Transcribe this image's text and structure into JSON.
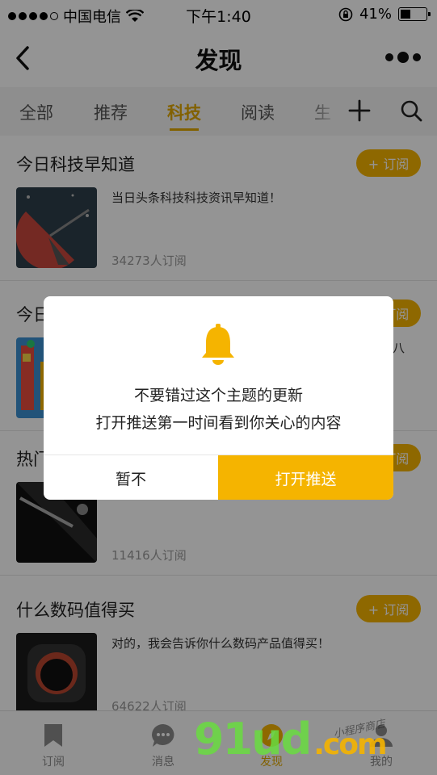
{
  "status_bar": {
    "carrier": "中国电信",
    "time": "下午1:40",
    "battery": "41%"
  },
  "nav": {
    "title": "发现"
  },
  "tabs": [
    {
      "label": "全部"
    },
    {
      "label": "推荐"
    },
    {
      "label": "科技"
    },
    {
      "label": "阅读"
    },
    {
      "label": "生"
    }
  ],
  "cards": [
    {
      "name": "今日科技早知道",
      "subscribe": "+ 订阅",
      "desc": "当日头条科技科技资讯早知道！",
      "count": "34273人订阅"
    },
    {
      "name": "今日",
      "subscribe": "+ 订阅",
      "desc": "八",
      "count": ""
    },
    {
      "name": "热门",
      "subscribe": "+ 订阅",
      "desc": "",
      "count": "11416人订阅"
    },
    {
      "name": "什么数码值得买",
      "subscribe": "+ 订阅",
      "desc": "对的，我会告诉你什么数码产品值得买！",
      "count": "64622人订阅"
    }
  ],
  "dialog": {
    "line1": "不要错过这个主题的更新",
    "line2": "打开推送第一时间看到你关心的内容",
    "cancel": "暂不",
    "confirm": "打开推送"
  },
  "tab_bar": [
    {
      "label": "订阅"
    },
    {
      "label": "消息"
    },
    {
      "label": "发现"
    },
    {
      "label": "我的"
    }
  ],
  "watermark": {
    "main": "91ud",
    "suffix": ".com",
    "signature": "小程序商店"
  },
  "colors": {
    "accent": "#f5b400",
    "active_tab": "#e0a800"
  }
}
